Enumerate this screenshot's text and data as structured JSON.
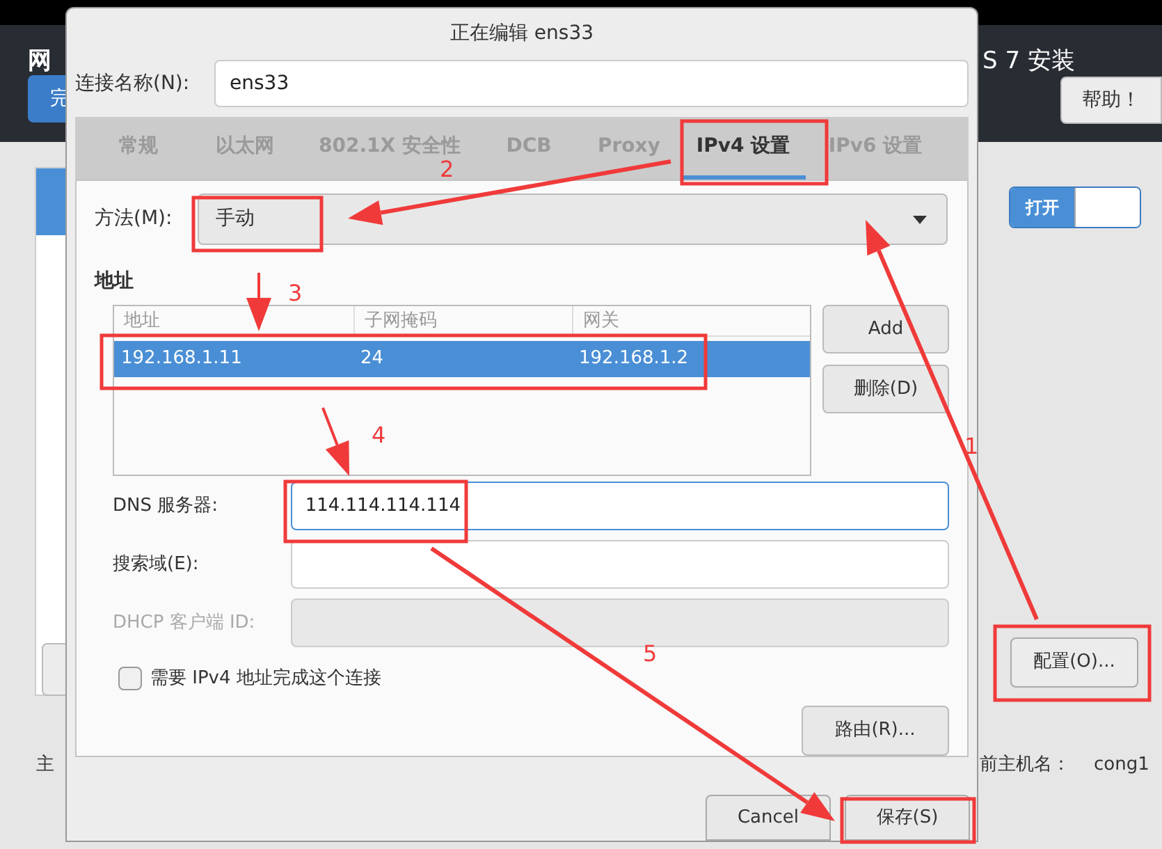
{
  "background": {
    "header_title": "网",
    "done_button": "完",
    "installer_title": "S 7 安装",
    "help_button": "帮助！",
    "toggle": {
      "label": "打开",
      "on": true
    },
    "configure_button": "配置(O)...",
    "hostname_label_left": "主",
    "hostname_label": "前主机名：",
    "hostname_value": "cong1"
  },
  "dialog": {
    "title": "正在编辑 ens33",
    "connection_name": {
      "label": "连接名称(N):",
      "value": "ens33"
    },
    "tabs": [
      {
        "label": "常规",
        "selected": false
      },
      {
        "label": "以太网",
        "selected": false
      },
      {
        "label": "802.1X 安全性",
        "selected": false
      },
      {
        "label": "DCB",
        "selected": false
      },
      {
        "label": "Proxy",
        "selected": false
      },
      {
        "label": "IPv4 设置",
        "selected": true
      },
      {
        "label": "IPv6 设置",
        "selected": false
      }
    ],
    "method": {
      "label": "方法(M):",
      "value": "手动"
    },
    "addresses": {
      "title": "地址",
      "columns": [
        "地址",
        "子网掩码",
        "网关"
      ],
      "rows": [
        {
          "cells": [
            "192.168.1.11",
            "24",
            "192.168.1.2"
          ],
          "selected": true
        }
      ],
      "buttons": [
        "Add",
        "删除(D)"
      ]
    },
    "fields": [
      {
        "label": "DNS 服务器:",
        "value": "114.114.114.114",
        "focused": true,
        "disabled": false
      },
      {
        "label": "搜索域(E):",
        "focused": false,
        "disabled": false
      },
      {
        "label": "DHCP 客户端 ID:",
        "focused": false,
        "disabled": true
      }
    ],
    "require_ipv4": {
      "label": "需要 IPv4 地址完成这个连接",
      "checked": false
    },
    "routes_button": "路由(R)...",
    "buttons": [
      "Cancel",
      "保存(S)"
    ]
  },
  "annotations": [
    "2",
    "3",
    "4",
    "1",
    "5"
  ]
}
